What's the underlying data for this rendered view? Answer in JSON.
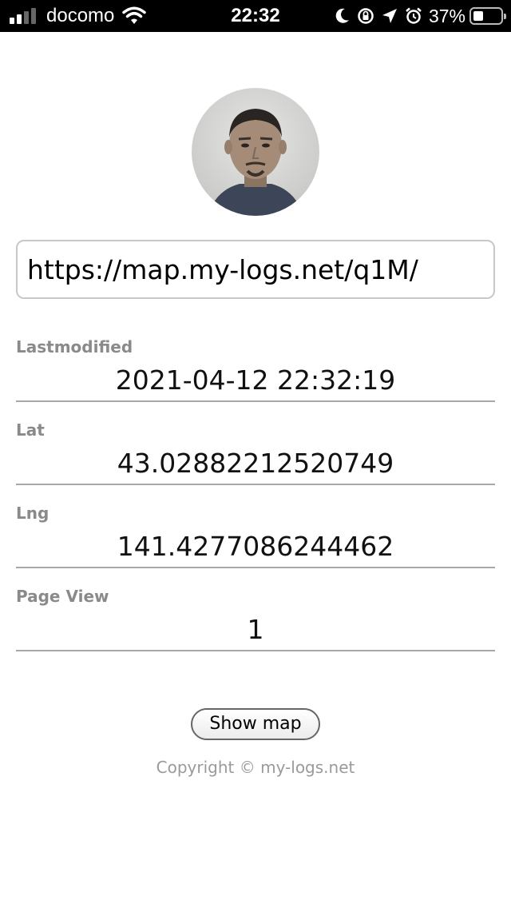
{
  "status_bar": {
    "carrier": "docomo",
    "time": "22:32",
    "battery_percent": "37%",
    "icons": [
      "signal-icon",
      "wifi-icon",
      "moon-icon",
      "orientation-lock-icon",
      "location-arrow-icon",
      "alarm-icon",
      "battery-icon"
    ]
  },
  "profile": {
    "avatar_icon": "person-photo"
  },
  "url_field": {
    "value": "https://map.my-logs.net/q1M/"
  },
  "fields": {
    "lastmodified": {
      "label": "Lastmodified",
      "value": "2021-04-12 22:32:19"
    },
    "lat": {
      "label": "Lat",
      "value": "43.02882212520749"
    },
    "lng": {
      "label": "Lng",
      "value": "141.4277086244462"
    },
    "page_view": {
      "label": "Page View",
      "value": "1"
    }
  },
  "actions": {
    "show_map_label": "Show map"
  },
  "footer": {
    "copyright": "Copyright © my-logs.net"
  },
  "colors": {
    "status_bar_bg": "#000000",
    "label": "#8a8a8a",
    "divider": "#a8a8a8",
    "footer": "#9a9a9a"
  }
}
